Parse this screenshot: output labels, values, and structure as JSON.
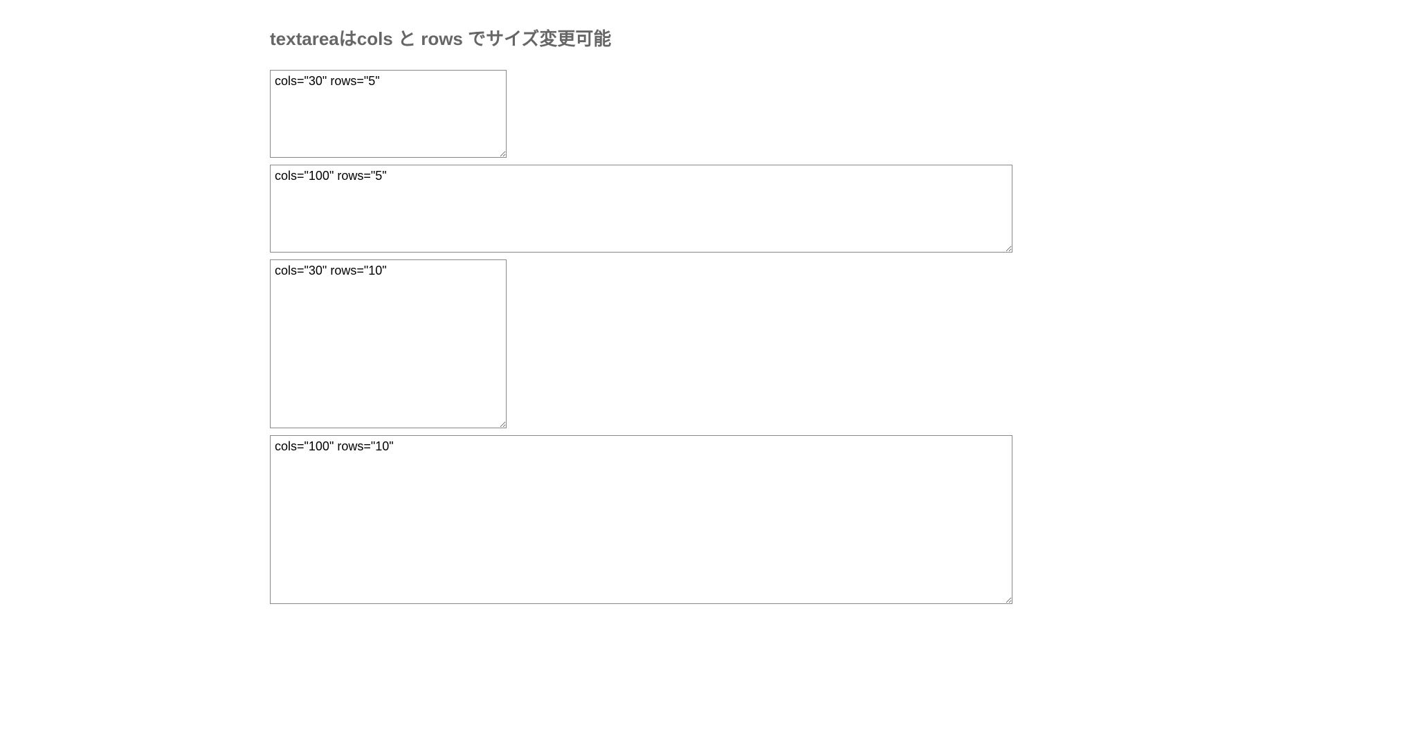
{
  "heading": "textareaはcols と rows でサイズ変更可能",
  "textareas": [
    {
      "cols": 30,
      "rows": 5,
      "value": "cols=\"30\" rows=\"5\""
    },
    {
      "cols": 100,
      "rows": 5,
      "value": "cols=\"100\" rows=\"5\""
    },
    {
      "cols": 30,
      "rows": 10,
      "value": "cols=\"30\" rows=\"10\""
    },
    {
      "cols": 100,
      "rows": 10,
      "value": "cols=\"100\" rows=\"10\""
    }
  ]
}
